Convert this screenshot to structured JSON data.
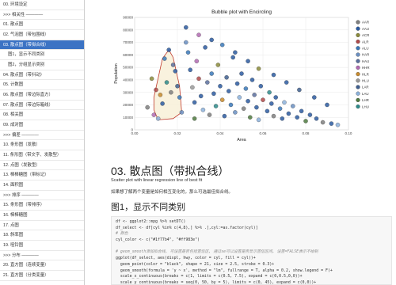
{
  "toc": {
    "items": [
      {
        "label": "00. 环境设定",
        "sub": false,
        "active": false
      },
      {
        "label": ">>> 相关性 ————",
        "sub": false,
        "active": false
      },
      {
        "label": "01. 散点图",
        "sub": false,
        "active": false
      },
      {
        "label": "02. 气泡图（带包围线）",
        "sub": false,
        "active": false
      },
      {
        "label": "03. 散点图（带拟合线）",
        "sub": false,
        "active": true
      },
      {
        "label": "图1，显示不同类别",
        "sub": true,
        "active": false
      },
      {
        "label": "图2，分组显示类别",
        "sub": true,
        "active": false
      },
      {
        "label": "04. 散点图（带抖动）",
        "sub": false,
        "active": false
      },
      {
        "label": "05. 计数图",
        "sub": false,
        "active": false
      },
      {
        "label": "06. 散点图（带边际直方）",
        "sub": false,
        "active": false
      },
      {
        "label": "07. 散点图（带边际箱线）",
        "sub": false,
        "active": false
      },
      {
        "label": "08. 相关图",
        "sub": false,
        "active": false
      },
      {
        "label": "09. 成对图",
        "sub": false,
        "active": false
      },
      {
        "label": ">>> 偏差 ————",
        "sub": false,
        "active": false
      },
      {
        "label": "10. 条形图（发散）",
        "sub": false,
        "active": false
      },
      {
        "label": "11. 条形图（带文字、发散型）",
        "sub": false,
        "active": false
      },
      {
        "label": "12. 点图（发散型）",
        "sub": false,
        "active": false
      },
      {
        "label": "13. 棒棒糖图（带标记）",
        "sub": false,
        "active": false
      },
      {
        "label": "14. 面积图",
        "sub": false,
        "active": false
      },
      {
        "label": ">>> 排序 ————",
        "sub": false,
        "active": false
      },
      {
        "label": "15. 条形图（带排序）",
        "sub": false,
        "active": false
      },
      {
        "label": "16. 棒棒糖图",
        "sub": false,
        "active": false
      },
      {
        "label": "17. 点图",
        "sub": false,
        "active": false
      },
      {
        "label": "18. 斜率图",
        "sub": false,
        "active": false
      },
      {
        "label": "19. 哑铃图",
        "sub": false,
        "active": false
      },
      {
        "label": ">>> 分布 ————",
        "sub": false,
        "active": false
      },
      {
        "label": "20. 直方图（连续变量）",
        "sub": false,
        "active": false
      },
      {
        "label": "21. 直方图（分类变量）",
        "sub": false,
        "active": false
      }
    ]
  },
  "chart_data": {
    "type": "scatter",
    "title": "Bubble plot with Encircling",
    "xlabel": "Area",
    "ylabel": "Population",
    "xlim": [
      0,
      0.1
    ],
    "ylim": [
      0,
      90000
    ],
    "xticks": [
      "0.00",
      "0.02",
      "0.04",
      "0.06",
      "0.08",
      "0.10"
    ],
    "yticks": [
      "0",
      "10000",
      "20000",
      "30000",
      "40000",
      "50000",
      "60000",
      "70000",
      "80000",
      "90000"
    ],
    "grid": true,
    "legend_position": "right",
    "encircle": {
      "fill": "#f8f0d8",
      "stroke": "#c0392b",
      "points": [
        [
          0.009,
          16000
        ],
        [
          0.009,
          26000
        ],
        [
          0.013,
          57000
        ],
        [
          0.016,
          64000
        ],
        [
          0.018,
          58000
        ],
        [
          0.021,
          35000
        ],
        [
          0.022,
          14000
        ],
        [
          0.018,
          9000
        ],
        [
          0.011,
          8000
        ]
      ]
    },
    "legend": [
      {
        "name": "AAR",
        "color": "#7f7f7f"
      },
      {
        "name": "AAU",
        "color": "#2b5aa0"
      },
      {
        "name": "ACR",
        "color": "#8b8b3a"
      },
      {
        "name": "ALR",
        "color": "#b04a4a"
      },
      {
        "name": "ALU",
        "color": "#3a78b8"
      },
      {
        "name": "HAR",
        "color": "#6a8fc2"
      },
      {
        "name": "HAU",
        "color": "#5a6f9e"
      },
      {
        "name": "HHR",
        "color": "#b26ab2"
      },
      {
        "name": "HLR",
        "color": "#c88b2e"
      },
      {
        "name": "HLU",
        "color": "#9a9a9a"
      },
      {
        "name": "LAR",
        "color": "#3f5f8f"
      },
      {
        "name": "LAU",
        "color": "#8cb2dc"
      },
      {
        "name": "LHR",
        "color": "#4f7a3f"
      },
      {
        "name": "LHU",
        "color": "#2e8b8b"
      }
    ],
    "points": [
      {
        "x": 0.006,
        "y": 18000,
        "s": "AAR"
      },
      {
        "x": 0.008,
        "y": 41000,
        "s": "ACR"
      },
      {
        "x": 0.01,
        "y": 32000,
        "s": "ALR"
      },
      {
        "x": 0.012,
        "y": 28000,
        "s": "HLR"
      },
      {
        "x": 0.014,
        "y": 57000,
        "s": "ALU"
      },
      {
        "x": 0.016,
        "y": 64000,
        "s": "AAU"
      },
      {
        "x": 0.018,
        "y": 52000,
        "s": "HAU"
      },
      {
        "x": 0.019,
        "y": 47000,
        "s": "AAU"
      },
      {
        "x": 0.02,
        "y": 35000,
        "s": "LAR"
      },
      {
        "x": 0.021,
        "y": 26000,
        "s": "ALU"
      },
      {
        "x": 0.022,
        "y": 14000,
        "s": "HAR"
      },
      {
        "x": 0.011,
        "y": 9000,
        "s": "LAU"
      },
      {
        "x": 0.009,
        "y": 12000,
        "s": "HHR"
      },
      {
        "x": 0.013,
        "y": 21000,
        "s": "AAU"
      },
      {
        "x": 0.015,
        "y": 38000,
        "s": "LHU"
      },
      {
        "x": 0.017,
        "y": 30000,
        "s": "AAR"
      },
      {
        "x": 0.024,
        "y": 70000,
        "s": "HAR"
      },
      {
        "x": 0.025,
        "y": 62000,
        "s": "ALU"
      },
      {
        "x": 0.026,
        "y": 48000,
        "s": "AAU"
      },
      {
        "x": 0.027,
        "y": 34000,
        "s": "HLU"
      },
      {
        "x": 0.028,
        "y": 22000,
        "s": "AAU"
      },
      {
        "x": 0.028,
        "y": 9000,
        "s": "LHR"
      },
      {
        "x": 0.029,
        "y": 55000,
        "s": "HHR"
      },
      {
        "x": 0.03,
        "y": 41000,
        "s": "ALR"
      },
      {
        "x": 0.031,
        "y": 27000,
        "s": "AAU"
      },
      {
        "x": 0.032,
        "y": 16000,
        "s": "LAU"
      },
      {
        "x": 0.033,
        "y": 66000,
        "s": "AAU"
      },
      {
        "x": 0.034,
        "y": 38000,
        "s": "HAU"
      },
      {
        "x": 0.035,
        "y": 12000,
        "s": "AAR"
      },
      {
        "x": 0.036,
        "y": 45000,
        "s": "ALU"
      },
      {
        "x": 0.037,
        "y": 29000,
        "s": "AAU"
      },
      {
        "x": 0.038,
        "y": 19000,
        "s": "LHU"
      },
      {
        "x": 0.039,
        "y": 52000,
        "s": "ACR"
      },
      {
        "x": 0.04,
        "y": 35000,
        "s": "AAU"
      },
      {
        "x": 0.041,
        "y": 24000,
        "s": "HLR"
      },
      {
        "x": 0.042,
        "y": 11000,
        "s": "AAU"
      },
      {
        "x": 0.043,
        "y": 42000,
        "s": "LAR"
      },
      {
        "x": 0.044,
        "y": 31000,
        "s": "AAU"
      },
      {
        "x": 0.045,
        "y": 20000,
        "s": "ALU"
      },
      {
        "x": 0.046,
        "y": 58000,
        "s": "AAU"
      },
      {
        "x": 0.047,
        "y": 14000,
        "s": "HAR"
      },
      {
        "x": 0.048,
        "y": 37000,
        "s": "AAU"
      },
      {
        "x": 0.049,
        "y": 26000,
        "s": "LAU"
      },
      {
        "x": 0.05,
        "y": 45000,
        "s": "AAU"
      },
      {
        "x": 0.051,
        "y": 17000,
        "s": "AAR"
      },
      {
        "x": 0.052,
        "y": 33000,
        "s": "ALU"
      },
      {
        "x": 0.053,
        "y": 23000,
        "s": "AAU"
      },
      {
        "x": 0.054,
        "y": 10000,
        "s": "LHR"
      },
      {
        "x": 0.055,
        "y": 40000,
        "s": "AAU"
      },
      {
        "x": 0.056,
        "y": 28000,
        "s": "HAU"
      },
      {
        "x": 0.057,
        "y": 18000,
        "s": "AAU"
      },
      {
        "x": 0.058,
        "y": 8000,
        "s": "LAU"
      },
      {
        "x": 0.059,
        "y": 35000,
        "s": "AAU"
      },
      {
        "x": 0.06,
        "y": 24000,
        "s": "ALR"
      },
      {
        "x": 0.062,
        "y": 15000,
        "s": "AAU"
      },
      {
        "x": 0.063,
        "y": 30000,
        "s": "LHU"
      },
      {
        "x": 0.064,
        "y": 21000,
        "s": "AAU"
      },
      {
        "x": 0.065,
        "y": 11000,
        "s": "AAR"
      },
      {
        "x": 0.066,
        "y": 26000,
        "s": "AAU"
      },
      {
        "x": 0.068,
        "y": 17000,
        "s": "ALU"
      },
      {
        "x": 0.069,
        "y": 9000,
        "s": "AAU"
      },
      {
        "x": 0.07,
        "y": 22000,
        "s": "LAU"
      },
      {
        "x": 0.072,
        "y": 13000,
        "s": "AAU"
      },
      {
        "x": 0.074,
        "y": 19000,
        "s": "HAR"
      },
      {
        "x": 0.076,
        "y": 10000,
        "s": "AAU"
      },
      {
        "x": 0.078,
        "y": 15000,
        "s": "AAU"
      },
      {
        "x": 0.08,
        "y": 7000,
        "s": "LHR"
      },
      {
        "x": 0.082,
        "y": 12000,
        "s": "AAU"
      },
      {
        "x": 0.085,
        "y": 9000,
        "s": "AAU"
      },
      {
        "x": 0.088,
        "y": 6000,
        "s": "AAR"
      },
      {
        "x": 0.092,
        "y": 5000,
        "s": "AAU"
      },
      {
        "x": 0.095,
        "y": 4000,
        "s": "LAU"
      },
      {
        "x": 0.024,
        "y": 82000,
        "s": "AAU"
      },
      {
        "x": 0.03,
        "y": 76000,
        "s": "HHR"
      },
      {
        "x": 0.036,
        "y": 72000,
        "s": "AAU"
      },
      {
        "x": 0.041,
        "y": 68000,
        "s": "ALU"
      },
      {
        "x": 0.047,
        "y": 62000,
        "s": "AAU"
      },
      {
        "x": 0.053,
        "y": 55000,
        "s": "AAU"
      },
      {
        "x": 0.058,
        "y": 49000,
        "s": "ACR"
      },
      {
        "x": 0.065,
        "y": 44000,
        "s": "AAU"
      },
      {
        "x": 0.071,
        "y": 38000,
        "s": "AAU"
      },
      {
        "x": 0.077,
        "y": 32000,
        "s": "LAR"
      },
      {
        "x": 0.084,
        "y": 26000,
        "s": "AAU"
      },
      {
        "x": 0.09,
        "y": 20000,
        "s": "AAU"
      }
    ]
  },
  "section": {
    "title": "03. 散点图（带拟合线）",
    "desc": "Scatter plot with linear regression line of best fit",
    "para": "如果想了解两个变量是如何相互变化的，那么可选最佳拟合线。",
    "subtitle": "图1，显示不同类别"
  },
  "code": {
    "lines": [
      {
        "text": "df <- ggplot2::mpg %>% setDT()",
        "kind": "code"
      },
      {
        "text": "df_select <- df[cyl %in% c(4,8),] %>% .[,cyl:=as.factor(cyl)]",
        "kind": "code"
      },
      {
        "text": "# 颜色",
        "kind": "comment"
      },
      {
        "text": "cyl_color <- c(\"#1f77b4\", \"#ff983e\")",
        "kind": "code"
      },
      {
        "text": "",
        "kind": "blank"
      },
      {
        "text": "# geom_smooth添加拟合线, 可设置是否包括置信区, 通过se可以设置是否显示置信区间, 设置=FALSE表示不绘制",
        "kind": "comment"
      },
      {
        "text": "ggplot(df_select, aes(displ, hwy, color = cyl, fill = cyl))+",
        "kind": "code"
      },
      {
        "text": "  geom_point(color = \"black\", shape = 21, size = 2.5, stroke = 0.3)+",
        "kind": "code"
      },
      {
        "text": "  geom_smooth(formula = 'y ~ x', method = \"lm\", fullrange = T, alpha = 0.2, show.legend = F)+",
        "kind": "code"
      },
      {
        "text": "  scale_x_continuous(breaks = c(1, limits = c(0.5, 7.5), expand = c(0,0.5,0,0))+",
        "kind": "code"
      },
      {
        "text": "  scale_y_continuous(breaks = seq(0, 50, by = 5), limits = c(0, 45), expand = c(0,0))+",
        "kind": "code"
      }
    ]
  }
}
